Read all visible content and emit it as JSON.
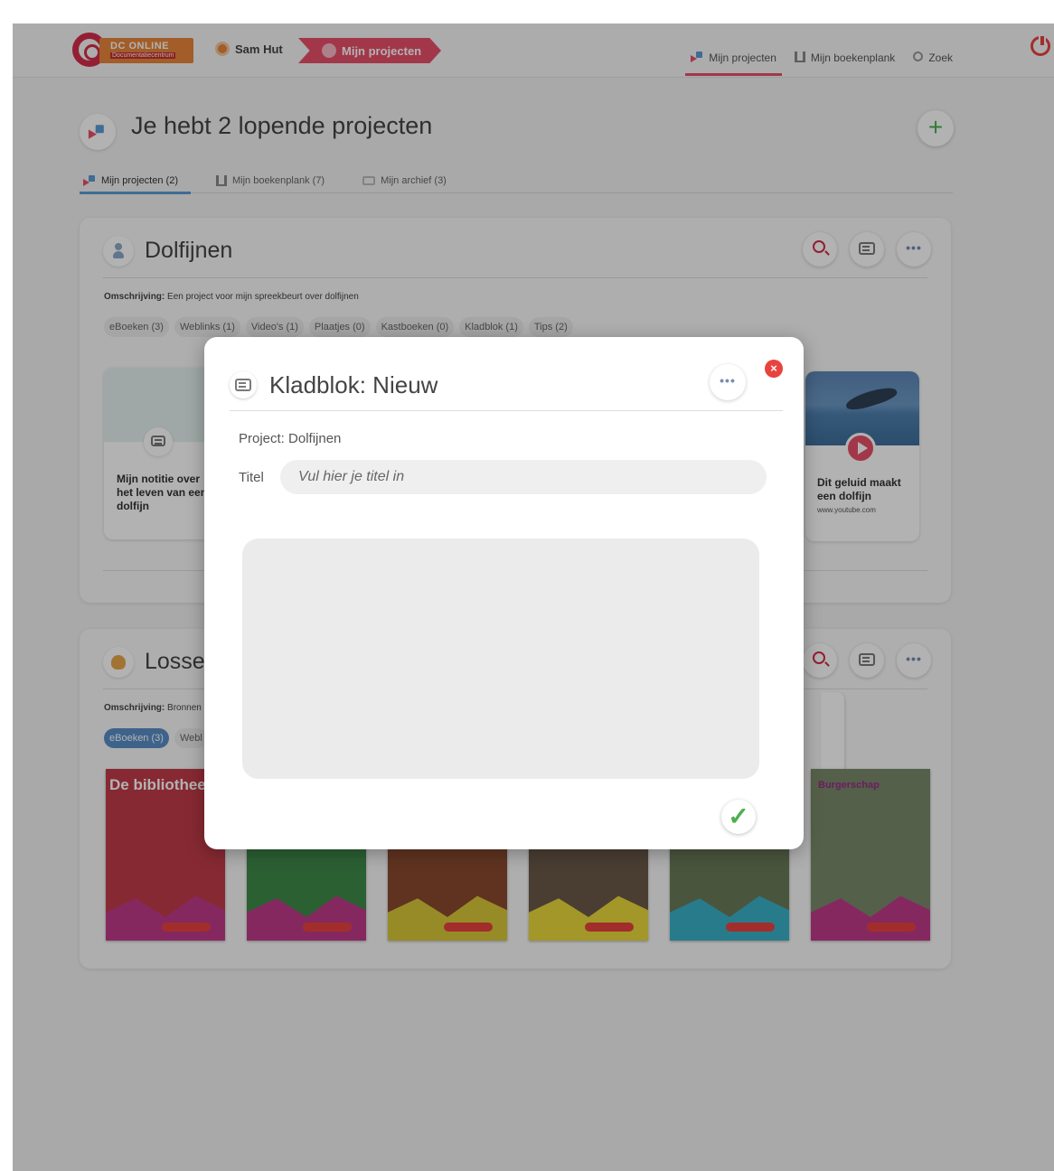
{
  "header": {
    "logo_title": "DC ONLINE",
    "logo_subtitle": "Documentatiecentrum",
    "user_name": "Sam Hut",
    "breadcrumb_current": "Mijn projecten",
    "nav": [
      {
        "label": "Mijn projecten",
        "icon": "projects-icon",
        "active": true
      },
      {
        "label": "Mijn boekenplank",
        "icon": "bookshelf-icon",
        "active": false
      },
      {
        "label": "Zoek",
        "icon": "search-icon",
        "active": false
      }
    ]
  },
  "page": {
    "title": "Je hebt 2 lopende projecten",
    "add_label": "+",
    "tabs": [
      {
        "label": "Mijn projecten (2)",
        "active": true
      },
      {
        "label": "Mijn boekenplank (7)",
        "active": false
      },
      {
        "label": "Mijn archief (3)",
        "active": false
      }
    ]
  },
  "projects": [
    {
      "title": "Dolfijnen",
      "desc_label": "Omschrijving:",
      "desc": "Een project voor mijn spreekbeurt over dolfijnen",
      "filters": [
        "eBoeken (3)",
        "Weblinks (1)",
        "Video's (1)",
        "Plaatjes (0)",
        "Kastboeken (0)",
        "Kladblok (1)",
        "Tips (2)"
      ],
      "note_card": {
        "title": "Mijn notitie over het leven van een dolfijn"
      },
      "video_card": {
        "title": "Dit geluid maakt een dolfijn",
        "url": "www.youtube.com"
      }
    },
    {
      "title": "Losse",
      "desc_label": "Omschrijving:",
      "desc": "Bronnen",
      "filters": [
        "eBoeken (3)",
        "Webl"
      ],
      "books": [
        {
          "title": "De bibliothee",
          "cover_color": "#c23b48"
        },
        {
          "title": "",
          "cover_color": "#3e8a4a"
        },
        {
          "title": "",
          "cover_color": "#8a4a2e"
        },
        {
          "title": "",
          "cover_color": "#6a5a4a"
        },
        {
          "title": "",
          "cover_color": "#6a7a5a"
        },
        {
          "title": "Burgerschap",
          "cover_color": "#7a8a6a"
        }
      ]
    }
  ],
  "modal": {
    "title": "Kladblok: Nieuw",
    "more_label": "•••",
    "close_label": "×",
    "project_label": "Project: Dolfijnen",
    "title_field_label": "Titel",
    "title_placeholder": "Vul hier je titel in",
    "title_value": "",
    "note_value": "",
    "confirm_label": "✓"
  },
  "colors": {
    "accent_pink": "#e9506a",
    "accent_orange": "#e8863a",
    "success_green": "#4caf50",
    "close_red": "#e8433f"
  }
}
